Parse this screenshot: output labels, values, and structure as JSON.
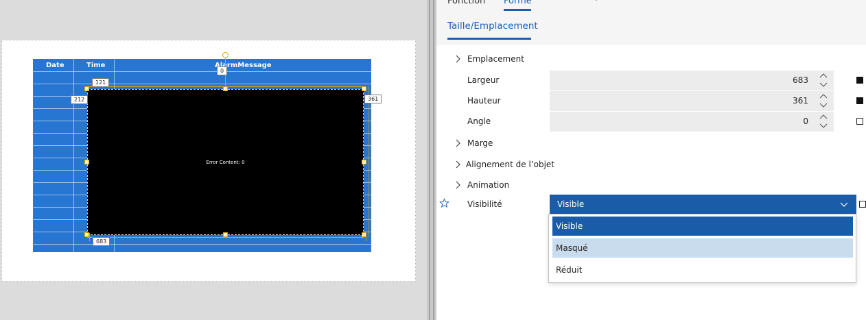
{
  "toptabs": {
    "fonction": "Fonction",
    "forme": "Forme"
  },
  "subtab": {
    "label": "Taille/Emplacement"
  },
  "canvas": {
    "columns": [
      "Date",
      "Time",
      "AlarmMessage"
    ],
    "error_content": "Error Content: 0",
    "dim_labels": {
      "top": "121",
      "left": "212",
      "right": "361",
      "bottom": "683",
      "angle": "0"
    }
  },
  "properties": {
    "emplacement": "Emplacement",
    "largeur": {
      "label": "Largeur",
      "value": "683"
    },
    "hauteur": {
      "label": "Hauteur",
      "value": "361"
    },
    "angle": {
      "label": "Angle",
      "value": "0"
    },
    "marge": "Marge",
    "alignement": "Alignement de l’objet",
    "animation": "Animation",
    "visibilite": {
      "label": "Visibilité",
      "value": "Visible"
    }
  },
  "dropdown": {
    "options": [
      "Visible",
      "Masqué",
      "Réduit"
    ]
  },
  "colors": {
    "accent": "#1a5fb4",
    "grid": "#2776d1",
    "handle": "#e0a200"
  }
}
